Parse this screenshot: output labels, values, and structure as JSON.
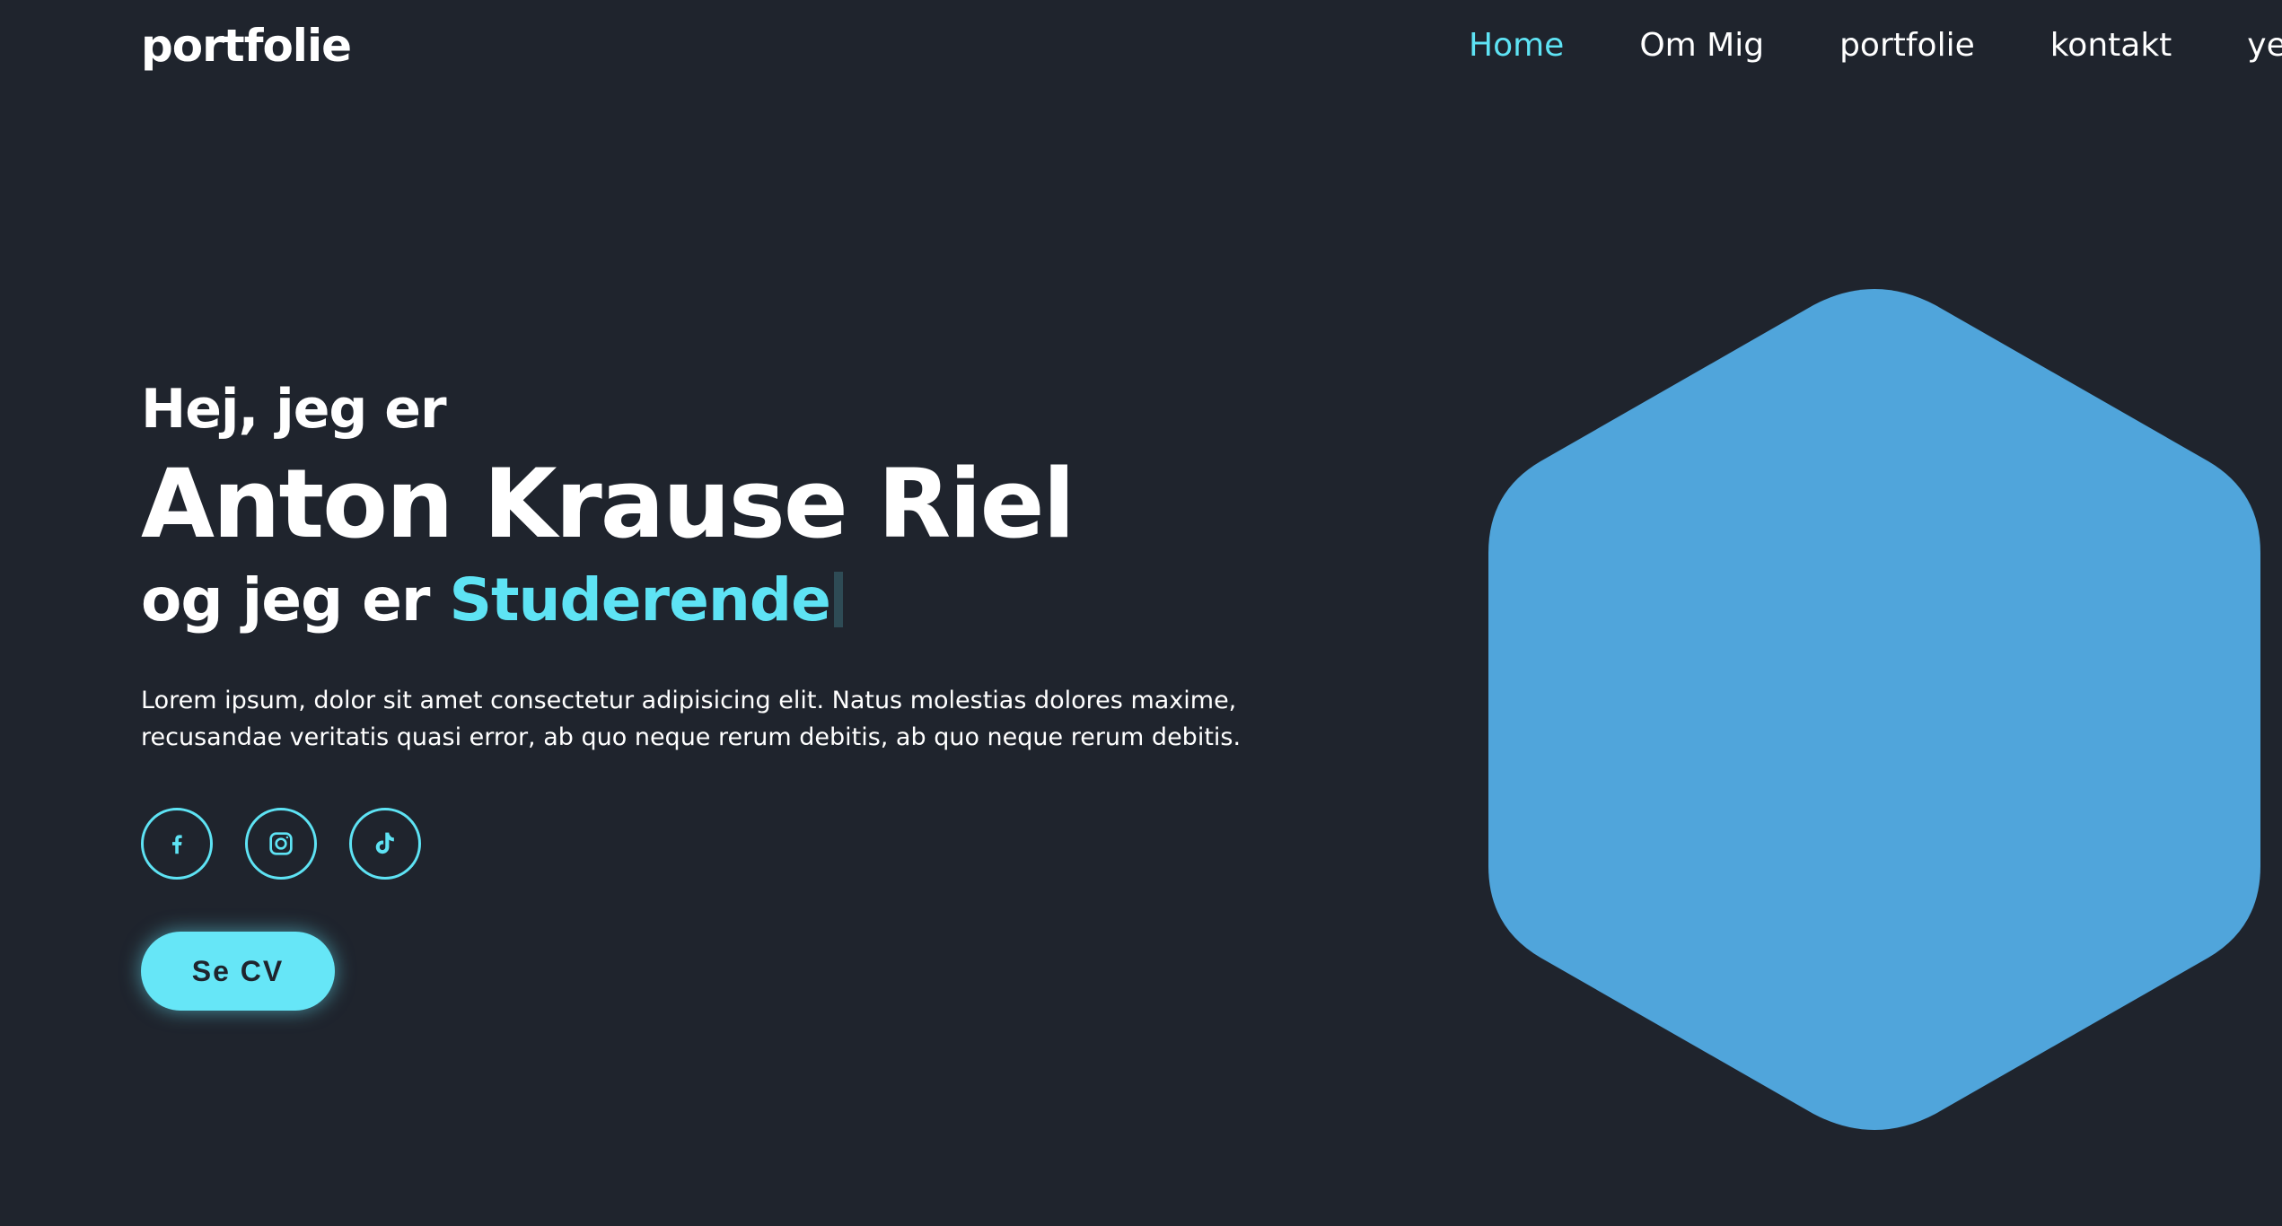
{
  "header": {
    "logo": "portfolie",
    "nav": [
      {
        "label": "Home",
        "active": true
      },
      {
        "label": "Om Mig",
        "active": false
      },
      {
        "label": "portfolie",
        "active": false
      },
      {
        "label": "kontakt",
        "active": false
      },
      {
        "label": "ye",
        "active": false
      }
    ]
  },
  "hero": {
    "greeting": "Hej, jeg er",
    "name": "Anton Krause Riel",
    "role_prefix": "og jeg er",
    "role": "Studerende",
    "description": "Lorem ipsum, dolor sit amet consectetur adipisicing elit. Natus molestias dolores maxime, recusandae veritatis quasi error, ab quo neque rerum debitis, ab quo neque rerum debitis.",
    "socials": [
      {
        "icon": "facebook-icon"
      },
      {
        "icon": "instagram-icon"
      },
      {
        "icon": "tiktok-icon"
      }
    ],
    "cv_button": "Se CV"
  },
  "colors": {
    "background": "#1f242d",
    "accent": "#5ee3f4",
    "hexagon": "#50a5db",
    "text": "#ffffff"
  }
}
